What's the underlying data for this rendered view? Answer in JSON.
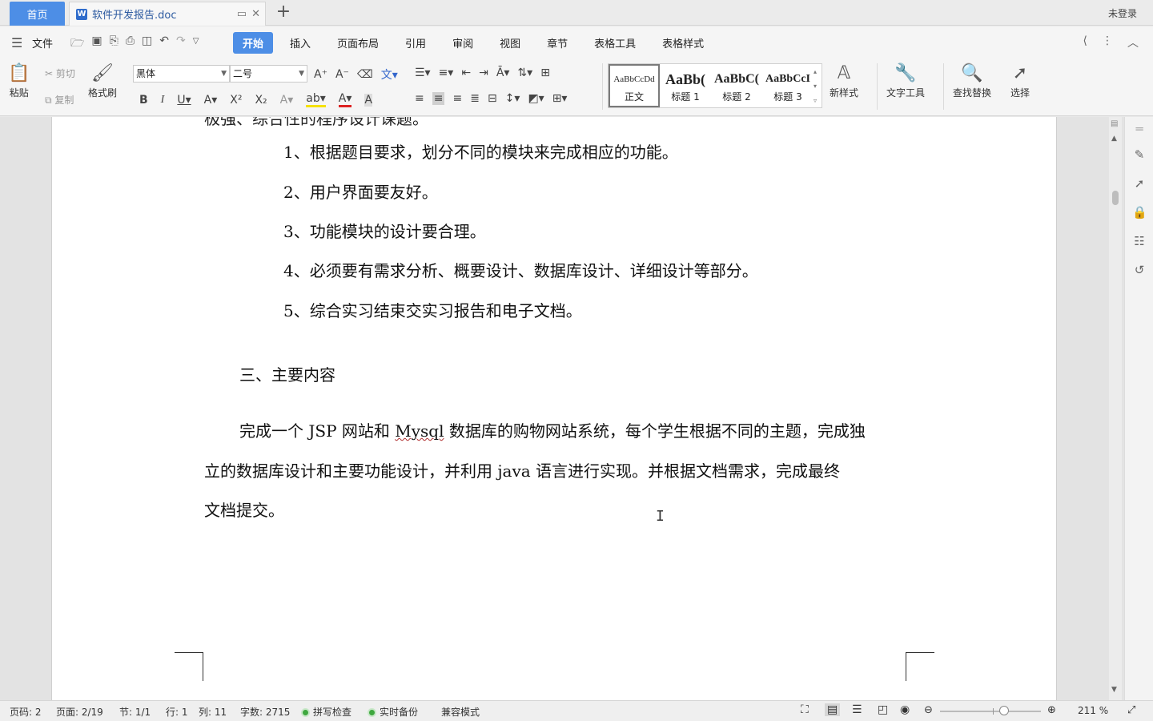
{
  "titlebar": {
    "home_tab": "首页",
    "doc_tab": "软件开发报告.doc",
    "add_tab": "+",
    "login": "未登录"
  },
  "menu": {
    "file": "文件",
    "items": [
      "开始",
      "插入",
      "页面布局",
      "引用",
      "审阅",
      "视图",
      "章节",
      "表格工具",
      "表格样式"
    ],
    "active": "开始"
  },
  "ribbon": {
    "paste": "粘贴",
    "cut": "剪切",
    "copy": "复制",
    "format_painter": "格式刷",
    "font_name": "黑体",
    "font_size": "二号",
    "styles": [
      {
        "sample": "AaBbCcDd",
        "label": "正文"
      },
      {
        "sample": "AaBb(",
        "label": "标题 1"
      },
      {
        "sample": "AaBbC(",
        "label": "标题 2"
      },
      {
        "sample": "AaBbCcI",
        "label": "标题 3"
      }
    ],
    "new_style": "新样式",
    "text_tools": "文字工具",
    "find_replace": "查找替换",
    "select": "选择"
  },
  "document": {
    "cut_line": "极强、综合性的程序设计课题。",
    "items": [
      "1、根据题目要求，划分不同的模块来完成相应的功能。",
      "2、用户界面要友好。",
      "3、功能模块的设计要合理。",
      "4、必须要有需求分析、概要设计、数据库设计、详细设计等部分。",
      "5、综合实习结束交实习报告和电子文档。"
    ],
    "heading": "三、主要内容",
    "para_line1_a": "完成一个 JSP 网站和 ",
    "para_line1_mysql": "Mysql",
    "para_line1_b": " 数据库的购物网站系统，每个学生根据不同的主题，完成独",
    "para_line2": "立的数据库设计和主要功能设计，并利用 java 语言进行实现。并根据文档需求，完成最终",
    "para_line3": "文档提交。"
  },
  "status": {
    "page_code": "页码: 2",
    "page": "页面: 2/19",
    "section": "节: 1/1",
    "row": "行: 1",
    "col": "列: 11",
    "word_count": "字数: 2715",
    "spell_check": "拼写检查",
    "backup": "实时备份",
    "compat": "兼容模式",
    "zoom": "211 %"
  },
  "colors": {
    "accent": "#4d8ee6",
    "status_ok": "#3fa83f"
  }
}
